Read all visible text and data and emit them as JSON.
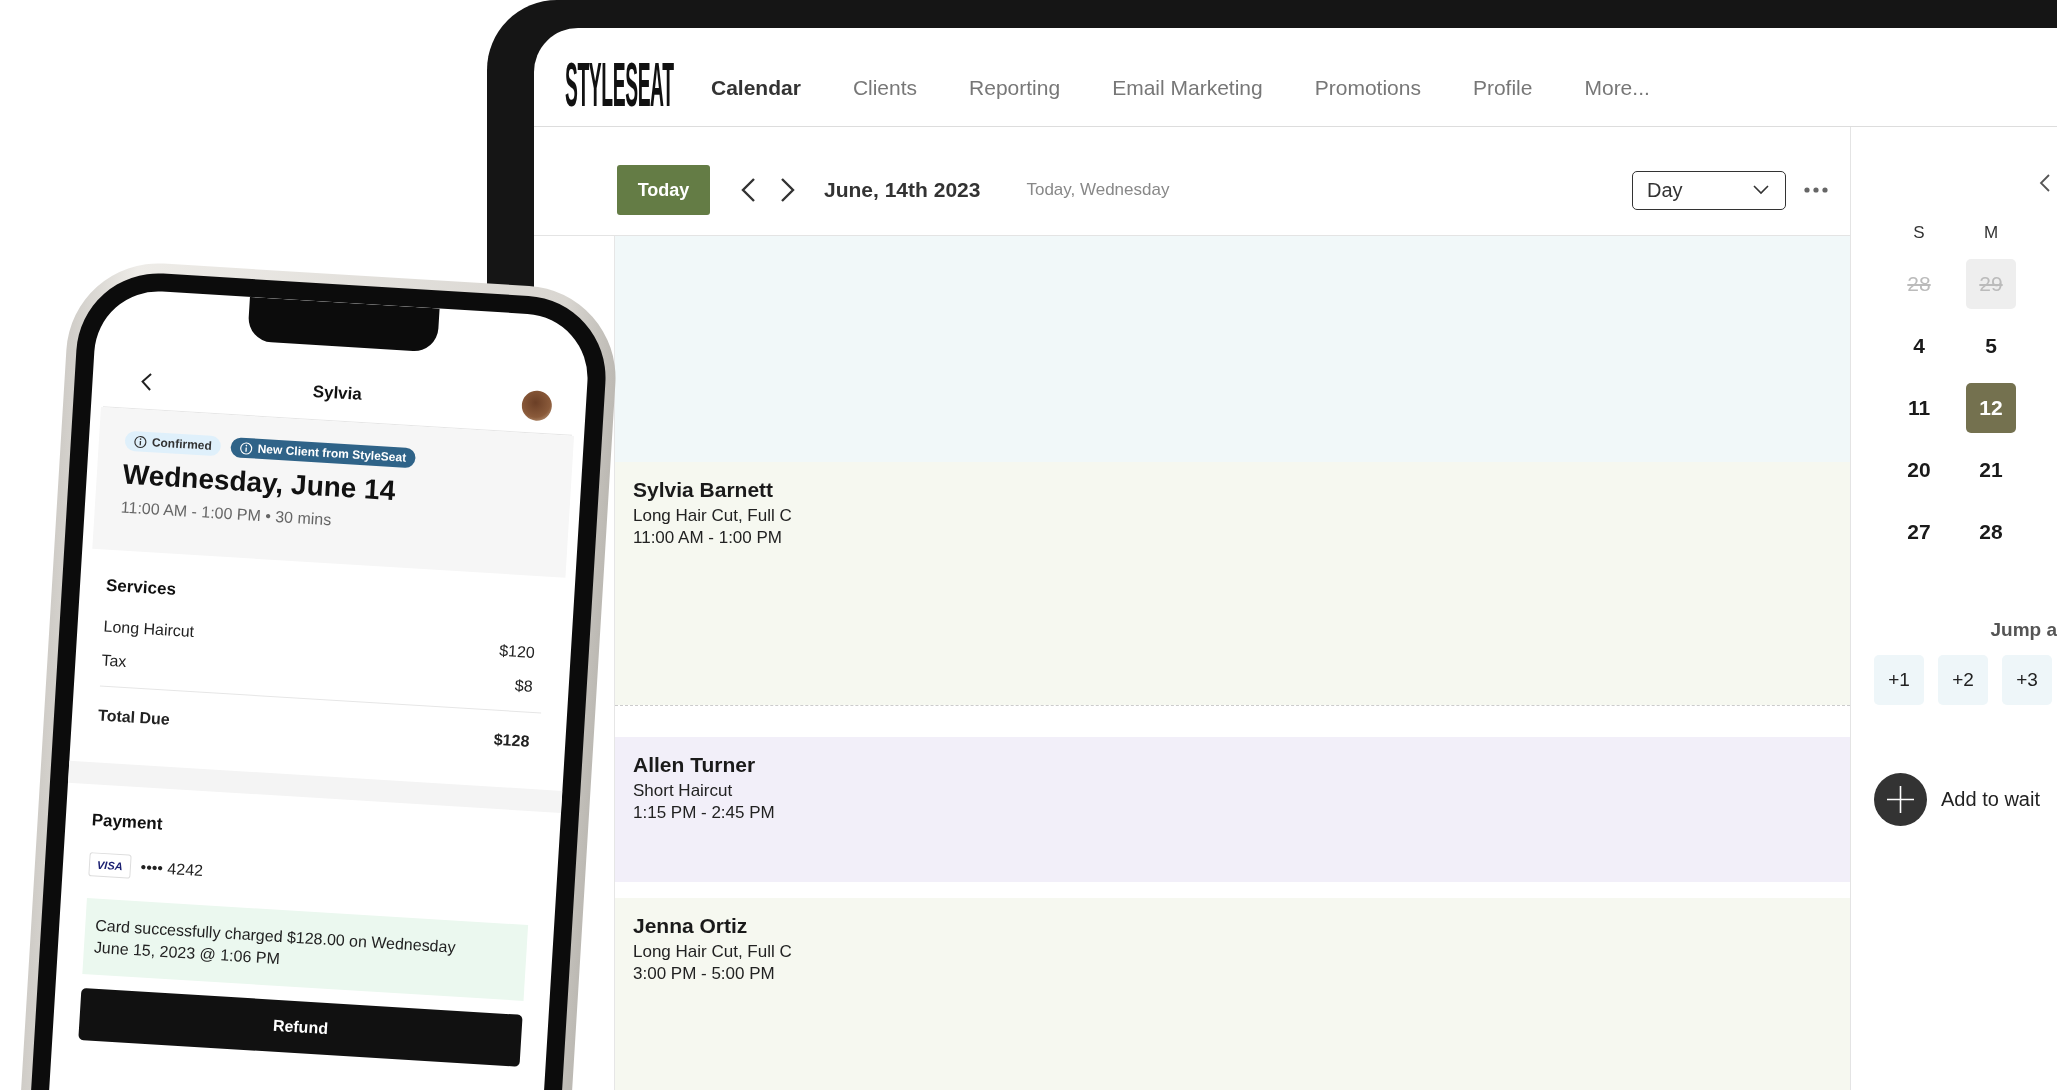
{
  "app": {
    "logo": "STYLESEAT",
    "nav": [
      {
        "label": "Calendar",
        "selected": true
      },
      {
        "label": "Clients",
        "selected": false
      },
      {
        "label": "Reporting",
        "selected": false
      },
      {
        "label": "Email Marketing",
        "selected": false
      },
      {
        "label": "Promotions",
        "selected": false
      },
      {
        "label": "Profile",
        "selected": false
      },
      {
        "label": "More...",
        "selected": false
      }
    ]
  },
  "toolbar": {
    "today_button": "Today",
    "date": "June, 14th 2023",
    "relative_day": "Today, Wednesday",
    "view_select": {
      "value": "Day"
    }
  },
  "events": [
    {
      "client": "Sylvia Barnett",
      "service": "Long Hair Cut, Full C",
      "time": "11:00 AM - 1:00 PM",
      "color": "#f6f8f0"
    },
    {
      "client": "Allen Turner",
      "service": "Short Haircut",
      "time": "1:15 PM - 2:45 PM",
      "color": "#f2eff9"
    },
    {
      "client": "Jenna Ortiz",
      "service": "Long Hair Cut, Full C",
      "time": "3:00 PM - 5:00 PM",
      "color": "#f6f8f0"
    }
  ],
  "mini_calendar": {
    "weekdays": [
      "S",
      "M"
    ],
    "days": [
      {
        "label": "28",
        "muted": true,
        "highlighted": false,
        "selected": false
      },
      {
        "label": "29",
        "muted": true,
        "highlighted": true,
        "selected": false
      },
      {
        "label": "4",
        "muted": false,
        "highlighted": false,
        "selected": false
      },
      {
        "label": "5",
        "muted": false,
        "highlighted": false,
        "selected": false
      },
      {
        "label": "11",
        "muted": false,
        "highlighted": false,
        "selected": false
      },
      {
        "label": "12",
        "muted": false,
        "highlighted": false,
        "selected": true
      },
      {
        "label": "20",
        "muted": false,
        "highlighted": false,
        "selected": false
      },
      {
        "label": "21",
        "muted": false,
        "highlighted": false,
        "selected": false
      },
      {
        "label": "27",
        "muted": false,
        "highlighted": false,
        "selected": false
      },
      {
        "label": "28",
        "muted": false,
        "highlighted": false,
        "selected": false
      }
    ]
  },
  "jump": {
    "label": "Jump a",
    "buttons": [
      "+1",
      "+2",
      "+3"
    ]
  },
  "waitlist": {
    "label": "Add to wait"
  },
  "phone": {
    "title": "Sylvia",
    "badges": [
      {
        "label": "Confirmed",
        "kind": "status"
      },
      {
        "label": "New Client from StyleSeat",
        "kind": "source"
      }
    ],
    "date": "Wednesday, June 14",
    "time": "11:00 AM - 1:00 PM • 30 mins",
    "services": {
      "heading": "Services",
      "items": [
        {
          "name": "Long Haircut",
          "price": "$120"
        },
        {
          "name": "Tax",
          "price": "$8"
        }
      ],
      "total_label": "Total Due",
      "total": "$128"
    },
    "payment": {
      "heading": "Payment",
      "card_brand": "VISA",
      "card_number": "•••• 4242",
      "message": "Card successfully charged $128.00 on Wednesday June 15, 2023 @ 1:06 PM"
    },
    "refund_button": "Refund"
  }
}
